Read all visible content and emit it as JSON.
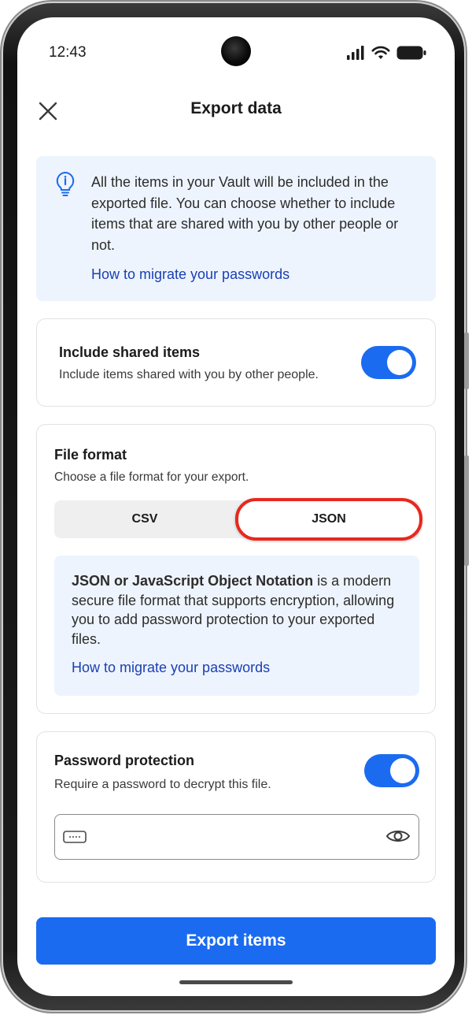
{
  "status": {
    "time": "12:43"
  },
  "header": {
    "title": "Export data"
  },
  "banner": {
    "text": "All the items in your Vault will be included in the exported file. You can choose whether to include items that are shared with you by other people or not.",
    "link": "How to migrate your passwords"
  },
  "shared": {
    "title": "Include shared items",
    "subtitle": "Include items shared with you by other people.",
    "enabled": true
  },
  "format": {
    "title": "File format",
    "subtitle": "Choose a file format for your export.",
    "options": [
      "CSV",
      "JSON"
    ],
    "selected": "JSON",
    "info_bold": "JSON or JavaScript Object Notation",
    "info_rest": " is a modern secure file format that supports encryption, allowing you to add password protection to your exported files.",
    "link": "How to migrate your passwords"
  },
  "password": {
    "title": "Password protection",
    "subtitle": "Require a password to decrypt this file.",
    "enabled": true,
    "value": ""
  },
  "actions": {
    "export_label": "Export items"
  },
  "colors": {
    "accent": "#1a6bf0",
    "link": "#1a3fb3",
    "highlight": "#e8281e",
    "info_bg": "#eef4fd"
  },
  "icons": [
    "close-icon",
    "lightbulb-icon",
    "password-dots-icon",
    "eye-icon",
    "signal-icon",
    "wifi-icon",
    "battery-icon"
  ]
}
